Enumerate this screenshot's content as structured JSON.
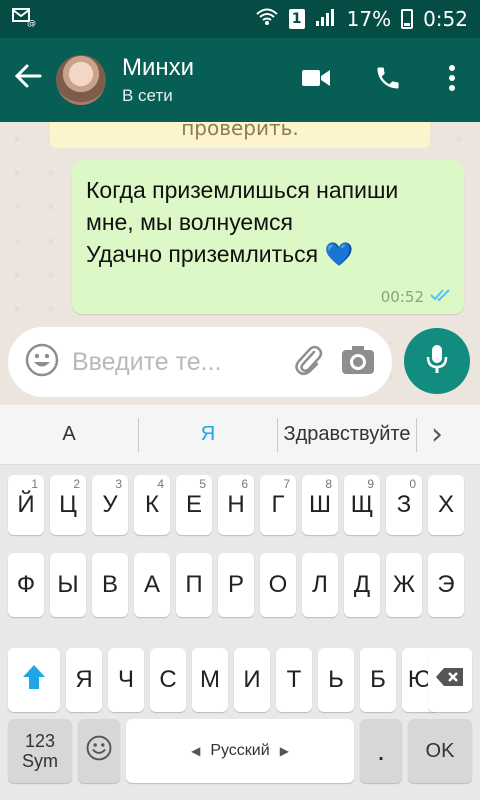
{
  "status_bar": {
    "left_icon": "messages-icon",
    "battery": "17%",
    "time": "0:52",
    "sim": "1"
  },
  "appbar": {
    "contact_name": "Минхи",
    "contact_status": "В сети",
    "back_icon": "back-arrow-icon",
    "video_icon": "video-camera-icon",
    "call_icon": "phone-icon",
    "menu_icon": "more-vertical-icon"
  },
  "chat": {
    "previous_fragment": "проверить.",
    "message": {
      "line1": "Когда приземлишься напиши",
      "line2": "мне, мы волнуемся",
      "line3": "Удачно приземлиться 💙",
      "time": "00:52",
      "status_icon": "double-check-icon"
    }
  },
  "composer": {
    "placeholder": "Введите те...",
    "emoji_icon": "emoji-icon",
    "attach_icon": "paperclip-icon",
    "camera_icon": "camera-icon",
    "mic_icon": "microphone-icon"
  },
  "suggestions": {
    "s1": "А",
    "s2": "Я",
    "s3": "Здравствуйте",
    "more": "›"
  },
  "keyboard": {
    "row1": [
      {
        "k": "Й",
        "n": "1"
      },
      {
        "k": "Ц",
        "n": "2"
      },
      {
        "k": "У",
        "n": "3"
      },
      {
        "k": "К",
        "n": "4"
      },
      {
        "k": "Е",
        "n": "5"
      },
      {
        "k": "Н",
        "n": "6"
      },
      {
        "k": "Г",
        "n": "7"
      },
      {
        "k": "Ш",
        "n": "8"
      },
      {
        "k": "Щ",
        "n": "9"
      },
      {
        "k": "З",
        "n": "0"
      },
      {
        "k": "Х",
        "n": ""
      }
    ],
    "row2": [
      "Ф",
      "Ы",
      "В",
      "А",
      "П",
      "Р",
      "О",
      "Л",
      "Д",
      "Ж",
      "Э"
    ],
    "row3": [
      "Я",
      "Ч",
      "С",
      "М",
      "И",
      "Т",
      "Ь",
      "Б",
      "Ю"
    ],
    "sym_label_top": "123",
    "sym_label_bottom": "Sym",
    "space_label": "Русский",
    "period_label": ".",
    "ok_label": "OK",
    "shift_icon": "shift-arrow-icon",
    "backspace_icon": "backspace-icon",
    "emoji_key_icon": "emoji-icon"
  }
}
